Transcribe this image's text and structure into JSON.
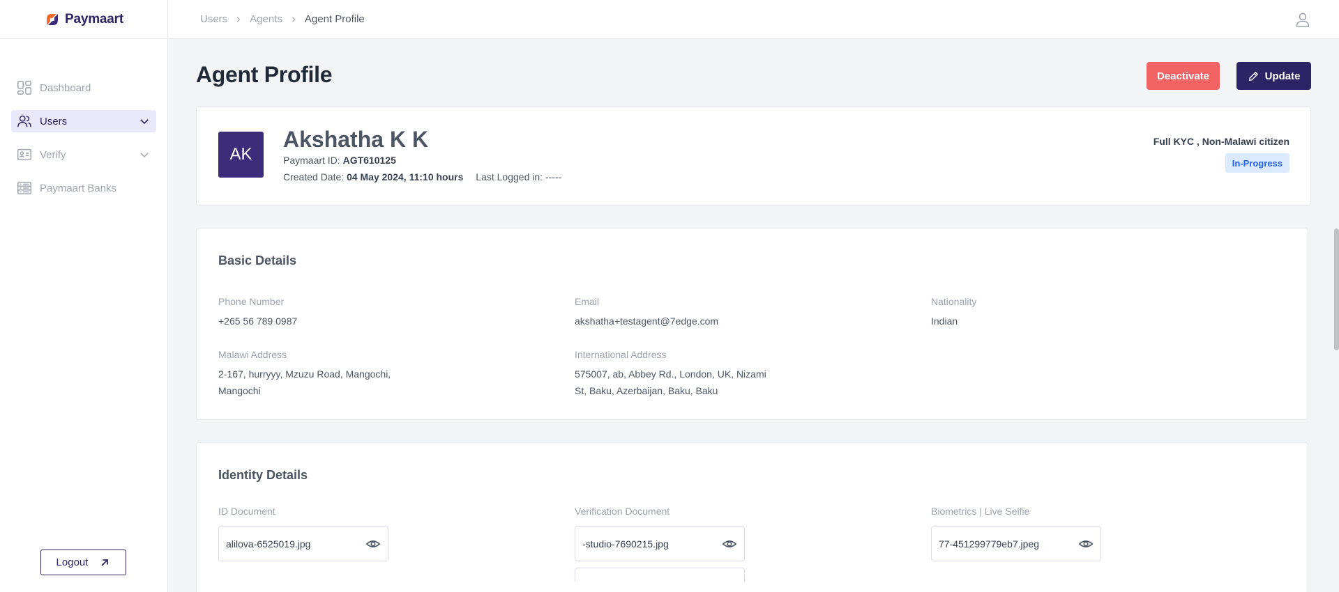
{
  "brand": {
    "name": "Paymaart",
    "accent": "#2d2465",
    "logo_orange": "#f26b2a",
    "logo_purple": "#3c2c7a"
  },
  "sidebar": {
    "items": [
      {
        "label": "Dashboard",
        "icon": "dashboard-icon",
        "active": false
      },
      {
        "label": "Users",
        "icon": "users-icon",
        "active": true
      },
      {
        "label": "Verify",
        "icon": "id-card-icon",
        "active": false
      },
      {
        "label": "Paymaart Banks",
        "icon": "bank-list-icon",
        "active": false
      }
    ],
    "logout_label": "Logout"
  },
  "breadcrumb": [
    "Users",
    "Agents",
    "Agent Profile"
  ],
  "page": {
    "title": "Agent Profile",
    "deactivate_label": "Deactivate",
    "update_label": "Update",
    "deactivate_color": "#f26464"
  },
  "profile": {
    "initials": "AK",
    "name": "Akshatha K K",
    "paymaart_id_label": "Paymaart ID:",
    "paymaart_id": "AGT610125",
    "created_label": "Created Date:",
    "created_value": "04 May 2024, 11:10 hours",
    "last_logged_label": "Last Logged in:",
    "last_logged_value": "-----",
    "kyc_type": "Full KYC , Non-Malawi citizen",
    "status": "In-Progress"
  },
  "basic_details": {
    "title": "Basic Details",
    "phone_label": "Phone Number",
    "phone_value": "+265 56 789 0987",
    "email_label": "Email",
    "email_value": "akshatha+testagent@7edge.com",
    "nationality_label": "Nationality",
    "nationality_value": "Indian",
    "malawi_address_label": "Malawi Address",
    "malawi_address_line1": "2-167, hurryyy, Mzuzu Road, Mangochi,",
    "malawi_address_line2": "Mangochi",
    "intl_address_label": "International Address",
    "intl_address_line1": "575007, ab, Abbey Rd., London, UK, Nizami",
    "intl_address_line2": "St, Baku, Azerbaijan, Baku, Baku"
  },
  "identity_details": {
    "title": "Identity Details",
    "id_doc_label": "ID Document",
    "id_doc_file": "alilova-6525019.jpg",
    "verification_doc_label": "Verification Document",
    "verification_doc_file": "-studio-7690215.jpg",
    "biometrics_label": "Biometrics | Live Selfie",
    "biometrics_file": "77-451299779eb7.jpeg"
  }
}
